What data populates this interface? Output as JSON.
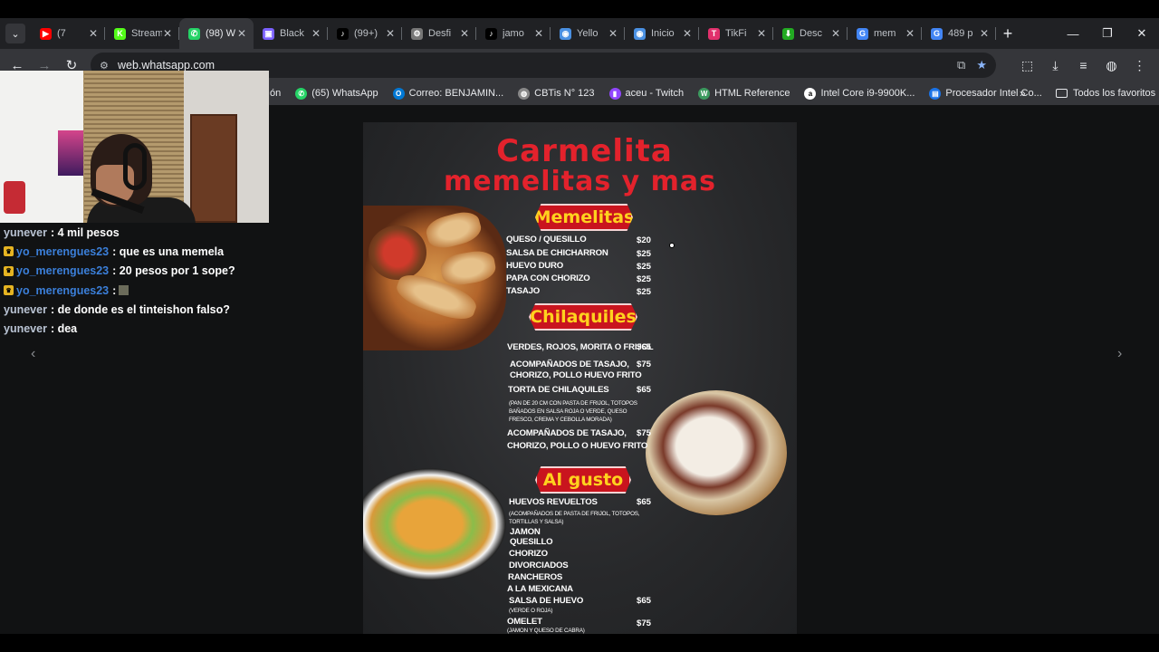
{
  "browser": {
    "tabs": [
      {
        "title": "(7",
        "favicon_color": "#ff0000",
        "favicon_glyph": "▶"
      },
      {
        "title": "Stream",
        "favicon_color": "#53fc18",
        "favicon_glyph": "K"
      },
      {
        "title": "(98) W",
        "favicon_color": "#25d366",
        "favicon_glyph": "✆",
        "active": true
      },
      {
        "title": "Black",
        "favicon_color": "#7b61ff",
        "favicon_glyph": "▣"
      },
      {
        "title": "(99+)",
        "favicon_color": "#000000",
        "favicon_glyph": "♪"
      },
      {
        "title": "Desfi",
        "favicon_color": "#777777",
        "favicon_glyph": "⚙"
      },
      {
        "title": "jamo",
        "favicon_color": "#000000",
        "favicon_glyph": "♪"
      },
      {
        "title": "Yello",
        "favicon_color": "#4a90e2",
        "favicon_glyph": "◉"
      },
      {
        "title": "Inicio",
        "favicon_color": "#4a90e2",
        "favicon_glyph": "◉"
      },
      {
        "title": "TikFi",
        "favicon_color": "#e1306c",
        "favicon_glyph": "T"
      },
      {
        "title": "Desc",
        "favicon_color": "#22aa22",
        "favicon_glyph": "⬇"
      },
      {
        "title": "mem",
        "favicon_color": "#4285f4",
        "favicon_glyph": "G"
      },
      {
        "title": "489 p",
        "favicon_color": "#4285f4",
        "favicon_glyph": "G"
      }
    ],
    "tab_close": "✕",
    "new_tab": "+",
    "window_controls": {
      "minimize": "—",
      "restore": "❐",
      "close": "✕"
    },
    "url": "web.whatsapp.com",
    "bookmarks": [
      {
        "label": "ón",
        "icon_color": "transparent",
        "glyph": ""
      },
      {
        "label": "(65) WhatsApp",
        "icon_color": "#25d366",
        "glyph": "✆"
      },
      {
        "label": "Correo: BENJAMIN...",
        "icon_color": "#0078d4",
        "glyph": "O"
      },
      {
        "label": "CBTis N° 123",
        "icon_color": "#888888",
        "glyph": "◍"
      },
      {
        "label": "aceu - Twitch",
        "icon_color": "#9146ff",
        "glyph": "▮"
      },
      {
        "label": "HTML Reference",
        "icon_color": "#3c9a5f",
        "glyph": "W"
      },
      {
        "label": "Intel Core i9-9900K...",
        "icon_color": "#ffffff",
        "glyph": "a"
      },
      {
        "label": "Procesador Intel Co...",
        "icon_color": "#1a73e8",
        "glyph": "▤"
      }
    ],
    "bookmarks_more": "»",
    "all_bookmarks": "Todos los favoritos"
  },
  "chat": [
    {
      "user": "yunever",
      "color": "grey",
      "badge": false,
      "message": ": 4 mil pesos"
    },
    {
      "user": "yo_merengues23",
      "color": "blue",
      "badge": true,
      "message": ": que es una memela"
    },
    {
      "user": "yo_merengues23",
      "color": "blue",
      "badge": true,
      "message": ": 20 pesos por 1 sope?"
    },
    {
      "user": "yo_merengues23",
      "color": "blue",
      "badge": true,
      "message": ":",
      "emote": true
    },
    {
      "user": "yunever",
      "color": "grey",
      "badge": false,
      "message": ": de donde es el tinteishon falso?"
    },
    {
      "user": "yunever",
      "color": "grey",
      "badge": false,
      "message": ": dea"
    }
  ],
  "viewer": {
    "prev": "‹",
    "next": "›"
  },
  "menu": {
    "title_line1": "Carmelita",
    "title_line2": "memelitas y mas",
    "sections": {
      "memelitas": "Memelitas",
      "chilaquiles": "Chilaquiles",
      "al_gusto": "Al gusto"
    },
    "memelitas_items": [
      {
        "name": "QUESO / QUESILLO",
        "price": "$20"
      },
      {
        "name": "SALSA DE CHICHARRON",
        "price": "$25"
      },
      {
        "name": "HUEVO DURO",
        "price": "$25"
      },
      {
        "name": "PAPA CON CHORIZO",
        "price": "$25"
      },
      {
        "name": "TASAJO",
        "price": "$25"
      }
    ],
    "chilaquiles_items": {
      "verdes": "VERDES, ROJOS, MORITA O FRIJOL",
      "verdes_price": "$65",
      "acomp1_line1": "ACOMPAÑADOS DE TASAJO,",
      "acomp1_line2": "CHORIZO, POLLO HUEVO FRITO",
      "acomp1_price": "$75",
      "torta": "TORTA DE CHILAQUILES",
      "torta_price": "$65",
      "torta_desc1": "(PAN DE 20 CM CON PASTA DE FRIJOL, TOTOPOS",
      "torta_desc2": "BAÑADOS EN SALSA ROJA O VERDE, QUESO",
      "torta_desc3": "FRESCO, CREMA Y CEBOLLA MORADA)",
      "acomp2_line1": "ACOMPAÑADOS DE TASAJO,",
      "acomp2_line2": "CHORIZO, POLLO O HUEVO FRITO",
      "acomp2_price": "$75"
    },
    "al_gusto_items": {
      "huevos": "HUEVOS REVUELTOS",
      "huevos_price": "$65",
      "huevos_desc1": "(ACOMPAÑADOS DE PASTA DE FRIJOL, TOTOPOS,",
      "huevos_desc2": "TORTILLAS Y SALSA)",
      "jamon": "JAMON",
      "quesillo": "QUESILLO",
      "chorizo": "CHORIZO",
      "divorciados": "DIVORCIADOS",
      "rancheros": "RANCHEROS",
      "mexicana": "A LA MEXICANA",
      "salsa_huevo": "SALSA DE HUEVO",
      "salsa_huevo_price": "$65",
      "salsa_huevo_desc": "(VERDE O ROJA)",
      "omelet": "OMELET",
      "omelet_price": "$75",
      "omelet_desc": "(JAMON Y QUESO DE CABRA)"
    }
  }
}
